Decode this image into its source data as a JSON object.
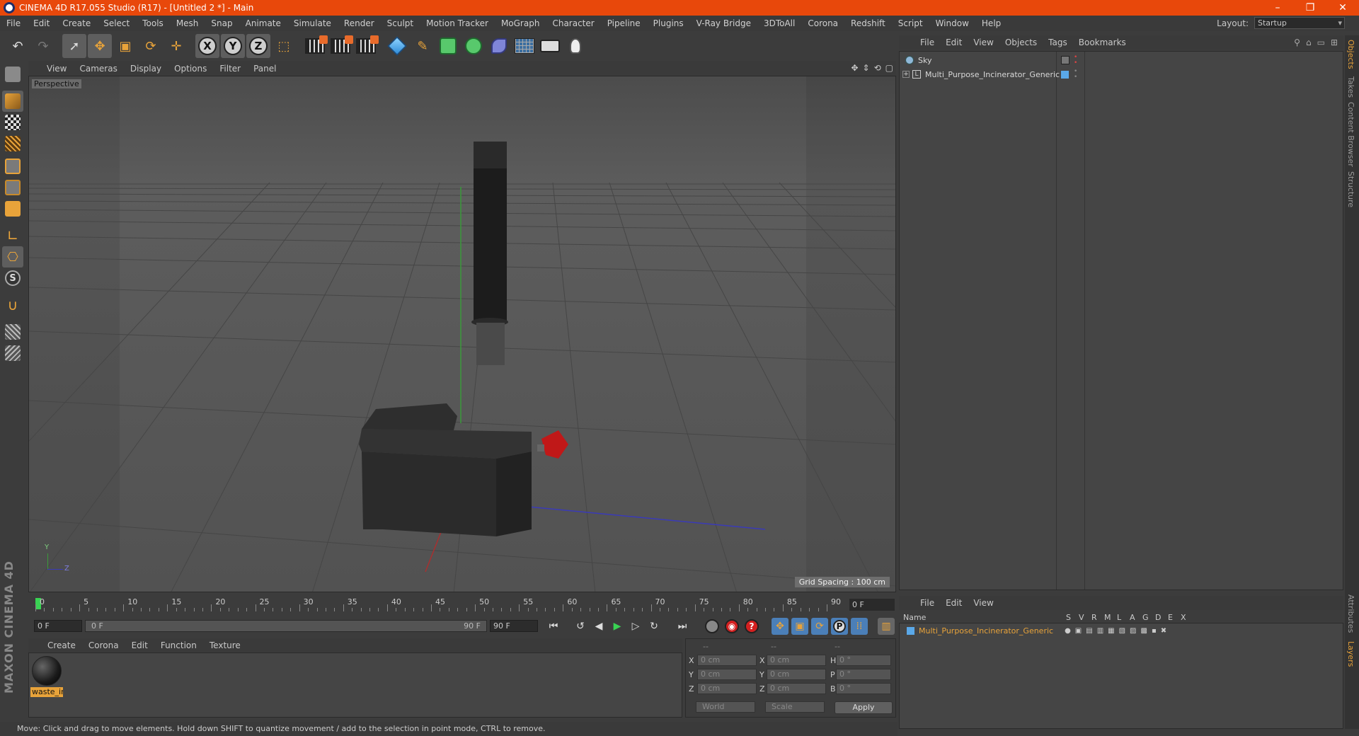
{
  "window": {
    "title": "CINEMA 4D R17.055 Studio (R17) - [Untitled 2 *] - Main",
    "minimize": "–",
    "restore": "❐",
    "close": "✕"
  },
  "menu": [
    "File",
    "Edit",
    "Create",
    "Select",
    "Tools",
    "Mesh",
    "Snap",
    "Animate",
    "Simulate",
    "Render",
    "Sculpt",
    "Motion Tracker",
    "MoGraph",
    "Character",
    "Pipeline",
    "Plugins",
    "V-Ray Bridge",
    "3DToAll",
    "Corona",
    "Redshift",
    "Script",
    "Window",
    "Help"
  ],
  "layout": {
    "label": "Layout:",
    "value": "Startup"
  },
  "viewport": {
    "menu": [
      "View",
      "Cameras",
      "Display",
      "Options",
      "Filter",
      "Panel"
    ],
    "camera_label": "Perspective",
    "grid_spacing": "Grid Spacing : 100 cm",
    "axis_labels": {
      "x": "X",
      "y": "Y",
      "z": "Z"
    }
  },
  "object_manager": {
    "menu": [
      "File",
      "Edit",
      "View",
      "Objects",
      "Tags",
      "Bookmarks"
    ],
    "objects": [
      {
        "name": "Sky"
      },
      {
        "name": "Multi_Purpose_Incinerator_Generic"
      }
    ]
  },
  "side_tabs": [
    "Objects",
    "Takes",
    "Content Browser",
    "Structure"
  ],
  "side_tabs_lower": [
    "Attributes",
    "Layers"
  ],
  "layer_manager": {
    "menu": [
      "File",
      "Edit",
      "View"
    ],
    "columns": {
      "name": "Name",
      "flags": [
        "S",
        "V",
        "R",
        "M",
        "L",
        "A",
        "G",
        "D",
        "E",
        "X"
      ]
    },
    "layer": "Multi_Purpose_Incinerator_Generic"
  },
  "timeline": {
    "ticks": [
      "0",
      "5",
      "10",
      "15",
      "20",
      "25",
      "30",
      "35",
      "40",
      "45",
      "50",
      "55",
      "60",
      "65",
      "70",
      "75",
      "80",
      "85",
      "90"
    ],
    "current_frame": "0 F",
    "start_field": "0 F",
    "slider_start": "0 F",
    "slider_end": "90 F",
    "end_field": "90 F"
  },
  "material_manager": {
    "menu": [
      "Create",
      "Corona",
      "Edit",
      "Function",
      "Texture"
    ],
    "materials": [
      {
        "name": "waste_in"
      }
    ]
  },
  "coordinates": {
    "headers": [
      "--",
      "--",
      "--"
    ],
    "rows": [
      {
        "a": "X",
        "av": "0 cm",
        "b": "X",
        "bv": "0 cm",
        "c": "H",
        "cv": "0 °"
      },
      {
        "a": "Y",
        "av": "0 cm",
        "b": "Y",
        "bv": "0 cm",
        "c": "P",
        "cv": "0 °"
      },
      {
        "a": "Z",
        "av": "0 cm",
        "b": "Z",
        "bv": "0 cm",
        "c": "B",
        "cv": "0 °"
      }
    ],
    "mode": "World",
    "size_mode": "Scale",
    "apply": "Apply"
  },
  "status": "Move: Click and drag to move elements. Hold down SHIFT to quantize movement / add to the selection in point mode, CTRL to remove.",
  "brand": "MAXON CINEMA 4D",
  "colors": {
    "accent": "#e8480b",
    "highlight": "#e8a33a",
    "play": "#39d353"
  }
}
